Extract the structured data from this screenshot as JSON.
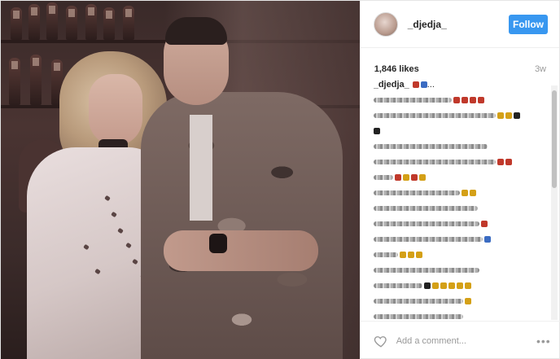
{
  "post": {
    "photo_alt": "",
    "user": {
      "username": "_djedja_"
    },
    "follow_label": "Follow",
    "likes": "1,846 likes",
    "time_ago": "3w",
    "caption_user": "_djedja_",
    "caption_tail": "...",
    "add_comment_placeholder": "Add a comment...",
    "more_label": "•••"
  },
  "colors": {
    "follow_button": "#3897f0",
    "likes_text": "#262626",
    "muted_text": "#999999"
  },
  "icons": {
    "heart": "heart-outline-icon",
    "more": "ellipsis-icon"
  }
}
